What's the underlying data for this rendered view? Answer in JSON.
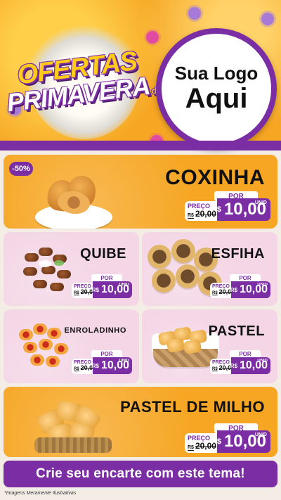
{
  "header": {
    "promo_title_line1": "OFERTAS",
    "promo_title_da": "da",
    "promo_title_line2": "PRIMAVERA",
    "logo_text_line1": "Sua Logo",
    "logo_text_line2": "Aqui"
  },
  "products": [
    {
      "name": "COXINHA",
      "badge": "-50%",
      "price_label_por": "POR",
      "price_label_preco": "PREÇO",
      "price_old_prefix": "R$",
      "price_old": "20,00",
      "price_new_prefix": "R$",
      "price_new": "10,00",
      "unit": "UNID"
    },
    {
      "name": "QUIBE",
      "price_label_por": "POR",
      "price_label_preco": "PREÇO",
      "price_old_prefix": "R$",
      "price_old": "20,00",
      "price_new_prefix": "R$",
      "price_new": "10,00",
      "unit": "UNID"
    },
    {
      "name": "ESFIHA",
      "price_label_por": "POR",
      "price_label_preco": "PREÇO",
      "price_old_prefix": "R$",
      "price_old": "20,00",
      "price_new_prefix": "R$",
      "price_new": "10,00",
      "unit": "UNID"
    },
    {
      "name": "ENROLADINHO",
      "price_label_por": "POR",
      "price_label_preco": "PREÇO",
      "price_old_prefix": "R$",
      "price_old": "20,00",
      "price_new_prefix": "R$",
      "price_new": "10,00",
      "unit": "UNID"
    },
    {
      "name": "PASTEL",
      "price_label_por": "POR",
      "price_label_preco": "PREÇO",
      "price_old_prefix": "R$",
      "price_old": "20,00",
      "price_new_prefix": "R$",
      "price_new": "10,00",
      "unit": "UNID"
    },
    {
      "name": "PASTEL DE MILHO",
      "price_label_por": "POR",
      "price_label_preco": "PREÇO",
      "price_old_prefix": "R$",
      "price_old": "20,00",
      "price_new_prefix": "R$",
      "price_new": "10,00",
      "unit": "UNID"
    }
  ],
  "footer": {
    "cta": "Crie seu encarte com este tema!",
    "disclaimer": "*Imagens Meramente Ilustrativas"
  },
  "colors": {
    "orange": "#f6a623",
    "purple": "#7b2ea3",
    "pink_card": "#f4d6e6"
  }
}
